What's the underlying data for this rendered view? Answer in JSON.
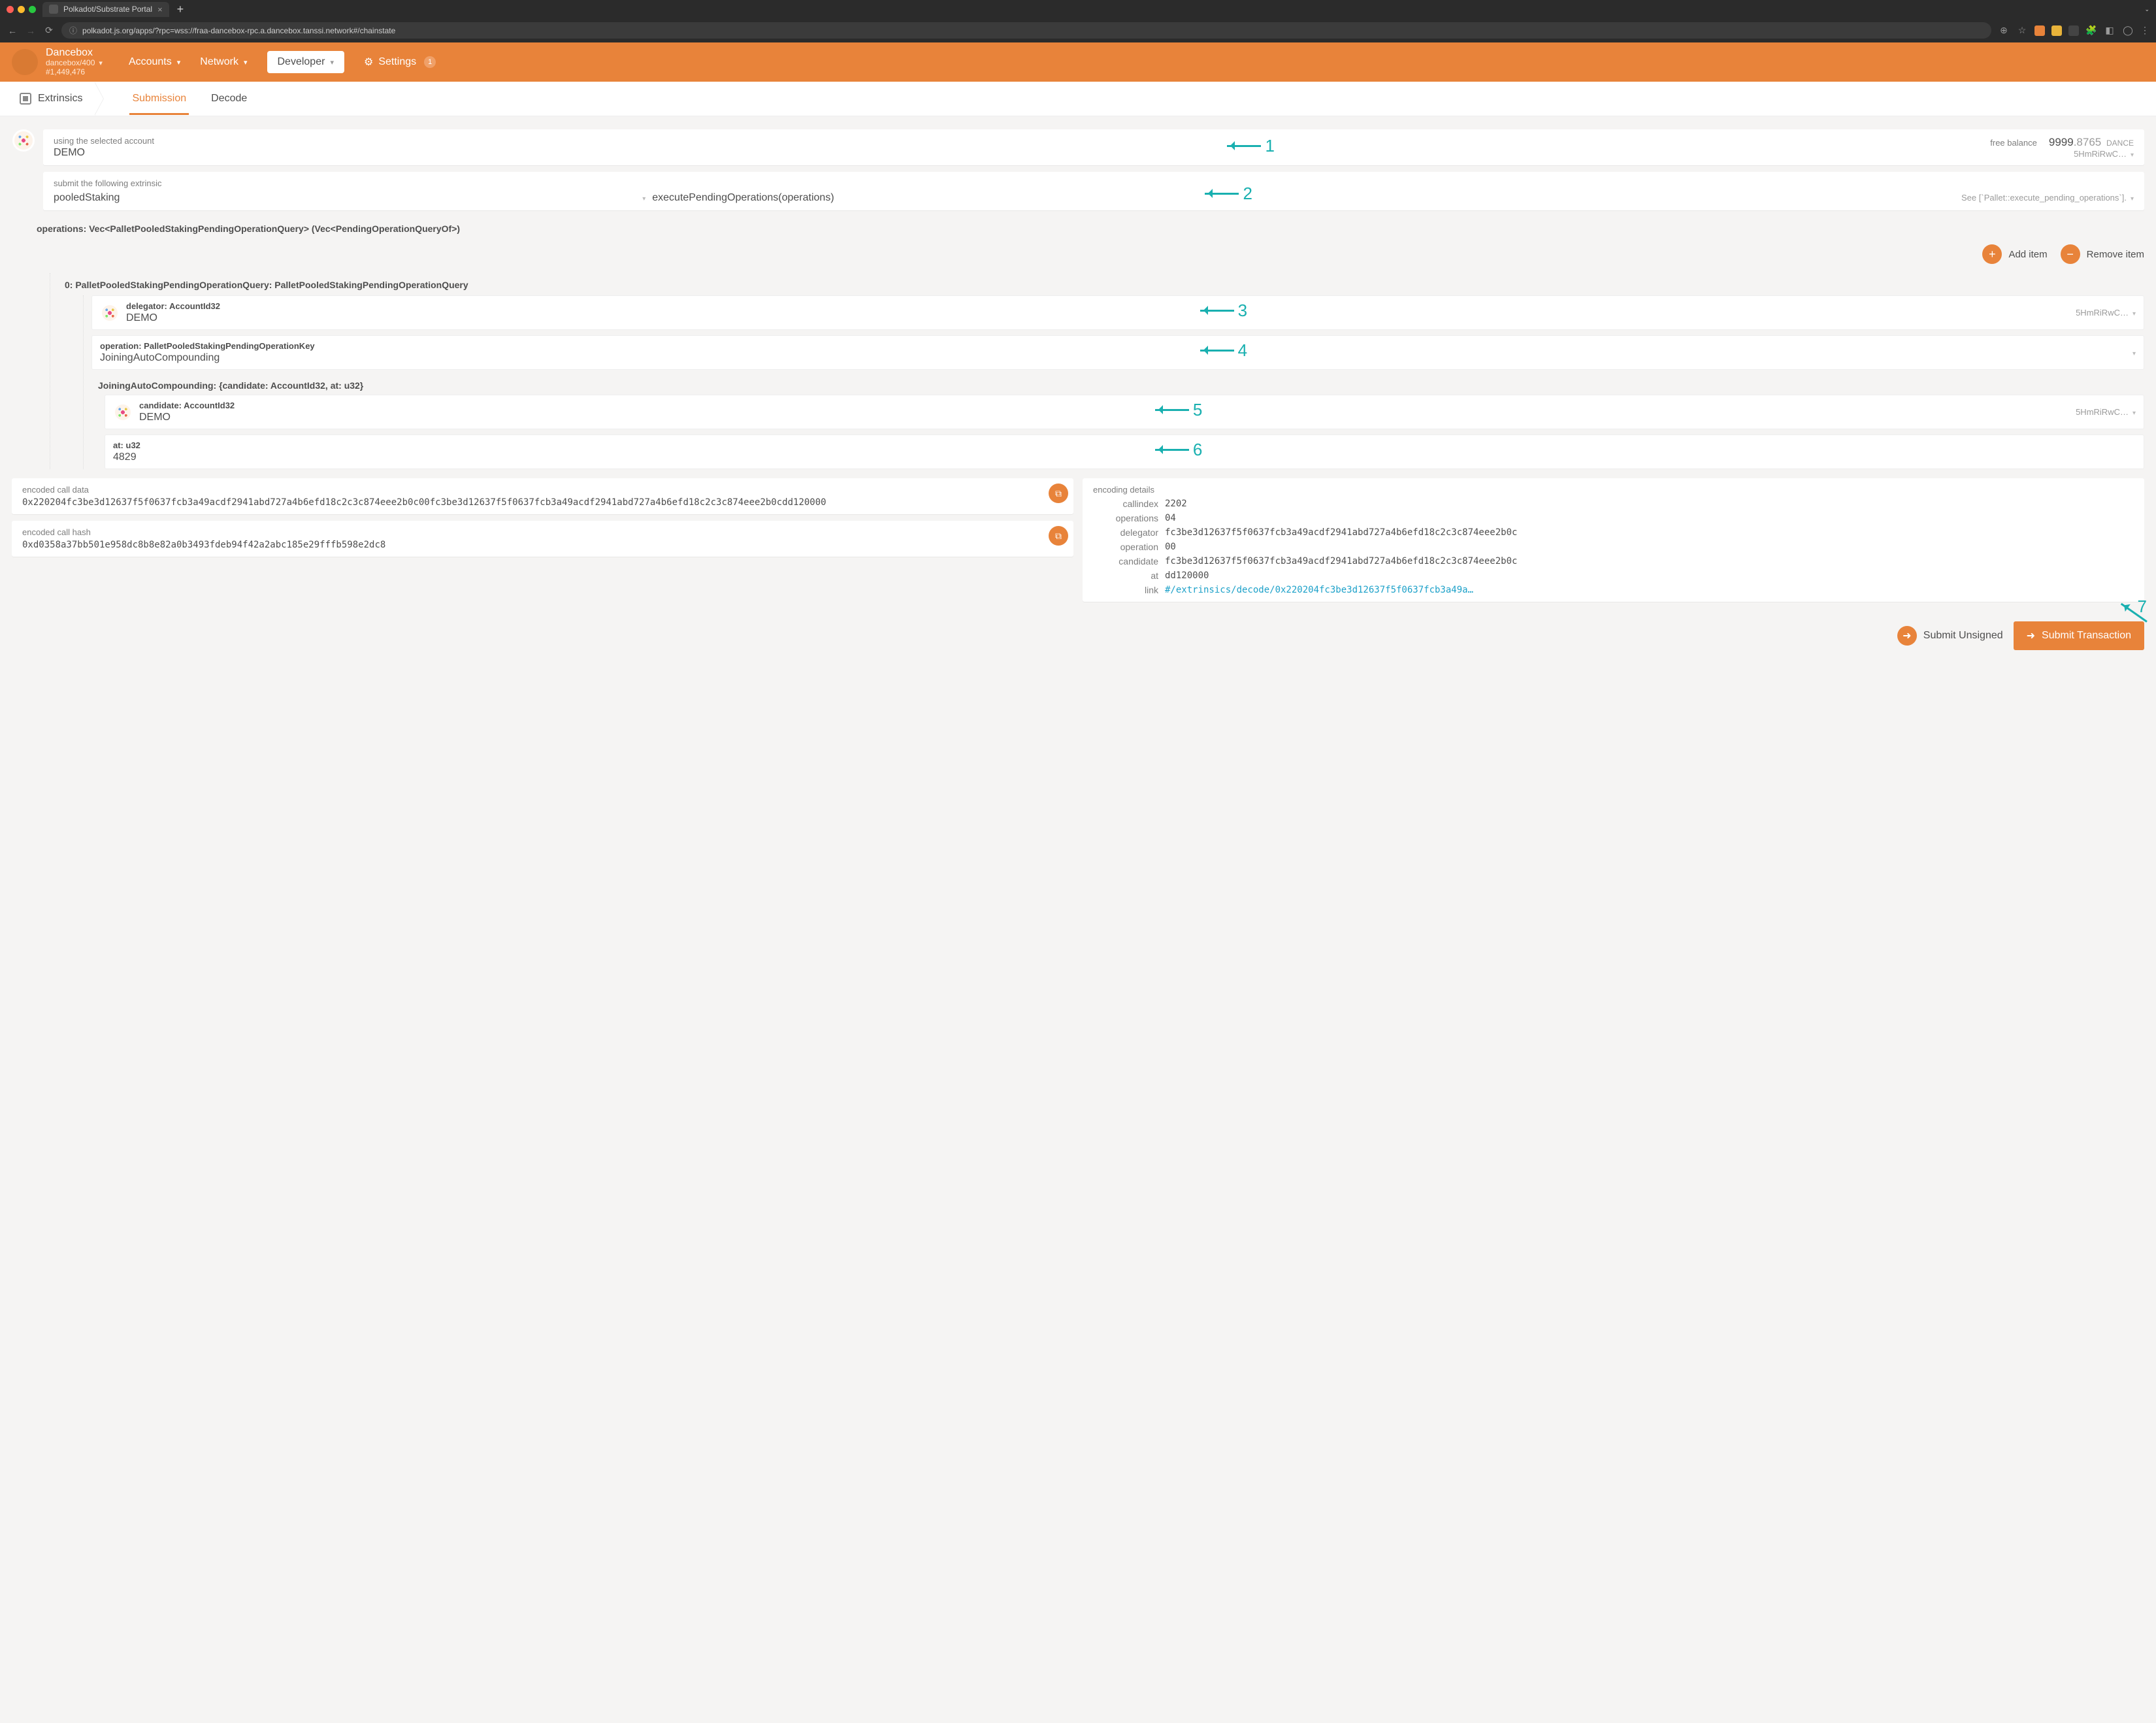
{
  "browser": {
    "tab_title": "Polkadot/Substrate Portal",
    "url": "polkadot.js.org/apps/?rpc=wss://fraa-dancebox-rpc.a.dancebox.tanssi.network#/chainstate"
  },
  "chain": {
    "name": "Dancebox",
    "spec": "dancebox/400",
    "block": "#1,449,476"
  },
  "nav": {
    "accounts": "Accounts",
    "network": "Network",
    "developer": "Developer",
    "settings": "Settings",
    "settings_badge": "1"
  },
  "subnav": {
    "crumb": "Extrinsics",
    "submission": "Submission",
    "decode": "Decode"
  },
  "account": {
    "label": "using the selected account",
    "name": "DEMO",
    "balance_label": "free balance",
    "balance_int": "9999",
    "balance_frac": ".8765",
    "unit": "DANCE",
    "addr_short": "5HmRiRwC…"
  },
  "extrinsic": {
    "label": "submit the following extrinsic",
    "pallet": "pooledStaking",
    "call": "executePendingOperations(operations)",
    "hint": "See [`Pallet::execute_pending_operations`]."
  },
  "params": {
    "vec_label": "operations: Vec<PalletPooledStakingPendingOperationQuery> (Vec<PendingOperationQueryOf>)",
    "add_item": "Add item",
    "remove_item": "Remove item",
    "index_label": "0: PalletPooledStakingPendingOperationQuery: PalletPooledStakingPendingOperationQuery",
    "delegator": {
      "label": "delegator: AccountId32",
      "value": "DEMO",
      "addr_short": "5HmRiRwC…"
    },
    "operation": {
      "label": "operation: PalletPooledStakingPendingOperationKey",
      "value": "JoiningAutoCompounding"
    },
    "struct_label": "JoiningAutoCompounding: {candidate: AccountId32, at: u32}",
    "candidate": {
      "label": "candidate: AccountId32",
      "value": "DEMO",
      "addr_short": "5HmRiRwC…"
    },
    "at": {
      "label": "at: u32",
      "value": "4829"
    }
  },
  "encoded": {
    "call_data_label": "encoded call data",
    "call_data": "0x220204fc3be3d12637f5f0637fcb3a49acdf2941abd727a4b6efd18c2c3c874eee2b0c00fc3be3d12637f5f0637fcb3a49acdf2941abd727a4b6efd18c2c3c874eee2b0cdd120000",
    "call_hash_label": "encoded call hash",
    "call_hash": "0xd0358a37bb501e958dc8b8e82a0b3493fdeb94f42a2abc185e29fffb598e2dc8"
  },
  "details": {
    "label": "encoding details",
    "callindex_k": "callindex",
    "callindex_v": "2202",
    "operations_k": "operations",
    "operations_v": "04",
    "delegator_k": "delegator",
    "delegator_v": "fc3be3d12637f5f0637fcb3a49acdf2941abd727a4b6efd18c2c3c874eee2b0c",
    "operation_k": "operation",
    "operation_v": "00",
    "candidate_k": "candidate",
    "candidate_v": "fc3be3d12637f5f0637fcb3a49acdf2941abd727a4b6efd18c2c3c874eee2b0c",
    "at_k": "at",
    "at_v": "dd120000",
    "link_k": "link",
    "link_v": "#/extrinsics/decode/0x220204fc3be3d12637f5f0637fcb3a49a…"
  },
  "buttons": {
    "unsigned": "Submit Unsigned",
    "submit": "Submit Transaction"
  },
  "annot": {
    "n1": "1",
    "n2": "2",
    "n3": "3",
    "n4": "4",
    "n5": "5",
    "n6": "6",
    "n7": "7"
  }
}
